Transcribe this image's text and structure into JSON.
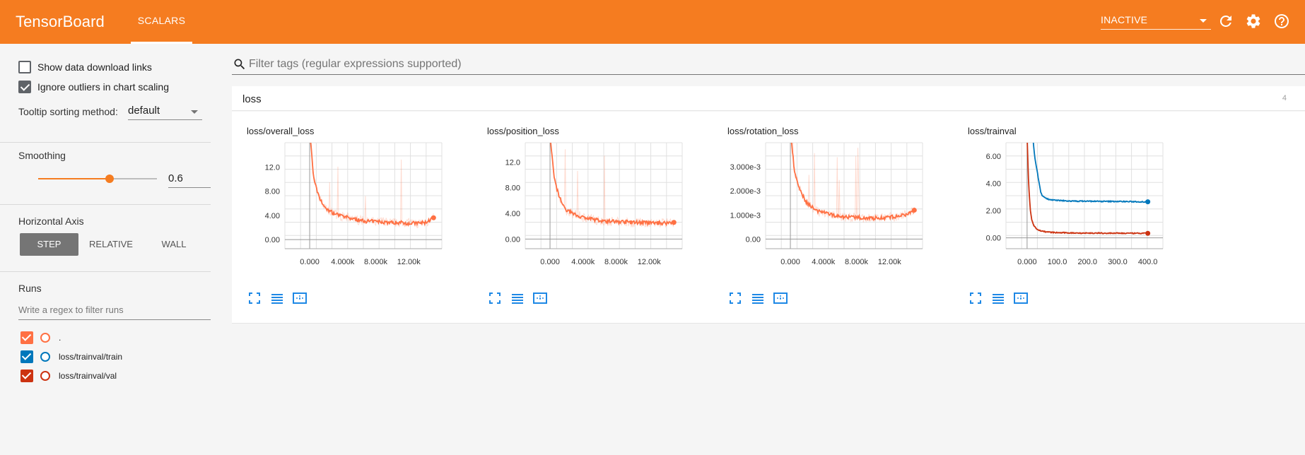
{
  "header": {
    "brand": "TensorBoard",
    "active_tab": "SCALARS",
    "reload_status": "INACTIVE",
    "icons": [
      "refresh-icon",
      "gear-icon",
      "help-icon"
    ],
    "accent_color": "#f57c20"
  },
  "sidebar": {
    "show_download_links": {
      "label": "Show data download links",
      "checked": false
    },
    "ignore_outliers": {
      "label": "Ignore outliers in chart scaling",
      "checked": true
    },
    "tooltip_sorting": {
      "label": "Tooltip sorting method:",
      "value": "default"
    },
    "smoothing": {
      "label": "Smoothing",
      "value": "0.6",
      "fraction": 0.6
    },
    "horizontal_axis": {
      "label": "Horizontal Axis",
      "options": [
        "STEP",
        "RELATIVE",
        "WALL"
      ],
      "selected": "STEP"
    },
    "runs": {
      "label": "Runs",
      "filter_placeholder": "Write a regex to filter runs",
      "items": [
        {
          "name": ".",
          "color": "#ff7043",
          "checked": true
        },
        {
          "name": "loss/trainval/train",
          "color": "#0077bb",
          "checked": true
        },
        {
          "name": "loss/trainval/val",
          "color": "#cc3311",
          "checked": true
        }
      ]
    }
  },
  "main": {
    "filter_placeholder": "Filter tags (regular expressions supported)",
    "category": {
      "name": "loss",
      "count": "4"
    }
  },
  "chart_data": [
    {
      "type": "line",
      "title": "loss/overall_loss",
      "x_ticks": [
        "0.000",
        "4.000k",
        "8.000k",
        "12.00k"
      ],
      "y_ticks": [
        "0.00",
        "4.00",
        "8.00",
        "12.0"
      ],
      "xlim": [
        -3000,
        16000
      ],
      "ylim": [
        -1.5,
        16
      ],
      "series": [
        {
          "name": ".",
          "color": "#ff7043",
          "x": [
            0,
            500,
            1000,
            1500,
            2000,
            3000,
            4000,
            5000,
            6000,
            7000,
            8000,
            9000,
            10000,
            11000,
            12000,
            13000,
            14000,
            15000
          ],
          "y": [
            18,
            10,
            7.5,
            6,
            5,
            4.3,
            3.8,
            3.5,
            3.2,
            3.0,
            3.0,
            2.9,
            2.8,
            2.8,
            2.7,
            2.7,
            2.8,
            3.6
          ]
        }
      ]
    },
    {
      "type": "line",
      "title": "loss/position_loss",
      "x_ticks": [
        "0.000",
        "4.000k",
        "8.000k",
        "12.00k"
      ],
      "y_ticks": [
        "0.00",
        "4.00",
        "8.00",
        "12.0"
      ],
      "xlim": [
        -3000,
        16000
      ],
      "ylim": [
        -1.5,
        15
      ],
      "series": [
        {
          "name": ".",
          "color": "#ff7043",
          "x": [
            0,
            500,
            1000,
            1500,
            2000,
            3000,
            4000,
            5000,
            6000,
            7000,
            8000,
            9000,
            10000,
            11000,
            12000,
            13000,
            14000,
            15000
          ],
          "y": [
            16,
            9.5,
            7,
            5.5,
            4.5,
            3.8,
            3.4,
            3.1,
            2.9,
            2.8,
            2.7,
            2.7,
            2.6,
            2.6,
            2.5,
            2.5,
            2.5,
            2.6
          ]
        }
      ]
    },
    {
      "type": "line",
      "title": "loss/rotation_loss",
      "x_ticks": [
        "0.000",
        "4.000k",
        "8.000k",
        "12.00k"
      ],
      "y_ticks": [
        "0.00",
        "1.000e-3",
        "2.000e-3",
        "3.000e-3"
      ],
      "xlim": [
        -3000,
        16000
      ],
      "ylim": [
        -0.0004,
        0.004
      ],
      "series": [
        {
          "name": ".",
          "color": "#ff7043",
          "x": [
            0,
            500,
            1000,
            1500,
            2000,
            3000,
            4000,
            5000,
            6000,
            7000,
            8000,
            9000,
            10000,
            11000,
            12000,
            13000,
            14000,
            15000
          ],
          "y": [
            0.0045,
            0.0028,
            0.0022,
            0.0018,
            0.0015,
            0.0012,
            0.0011,
            0.001,
            0.00095,
            0.0009,
            0.0009,
            0.00088,
            0.00087,
            0.00088,
            0.0009,
            0.00095,
            0.001,
            0.0012
          ]
        }
      ]
    },
    {
      "type": "line",
      "title": "loss/trainval",
      "x_ticks": [
        "0.000",
        "100.0",
        "200.0",
        "300.0",
        "400.0"
      ],
      "y_ticks": [
        "0.00",
        "2.00",
        "4.00",
        "6.00"
      ],
      "xlim": [
        -70,
        450
      ],
      "ylim": [
        -0.8,
        7
      ],
      "series": [
        {
          "name": "loss/trainval/train",
          "color": "#0077bb",
          "x": [
            20,
            25,
            30,
            35,
            40,
            45,
            50,
            60,
            70,
            80,
            100,
            150,
            200,
            250,
            300,
            350,
            400
          ],
          "y": [
            7.2,
            6.0,
            5.3,
            4.7,
            4.0,
            3.4,
            3.1,
            2.95,
            2.85,
            2.8,
            2.75,
            2.7,
            2.7,
            2.68,
            2.68,
            2.66,
            2.65
          ]
        },
        {
          "name": "loss/trainval/val",
          "color": "#cc3311",
          "x": [
            0,
            5,
            10,
            15,
            20,
            30,
            40,
            50,
            60,
            80,
            100,
            150,
            200,
            250,
            300,
            350,
            400
          ],
          "y": [
            7.5,
            4.0,
            2.2,
            1.4,
            1.0,
            0.7,
            0.55,
            0.5,
            0.45,
            0.4,
            0.38,
            0.36,
            0.35,
            0.34,
            0.34,
            0.33,
            0.33
          ]
        }
      ]
    }
  ]
}
